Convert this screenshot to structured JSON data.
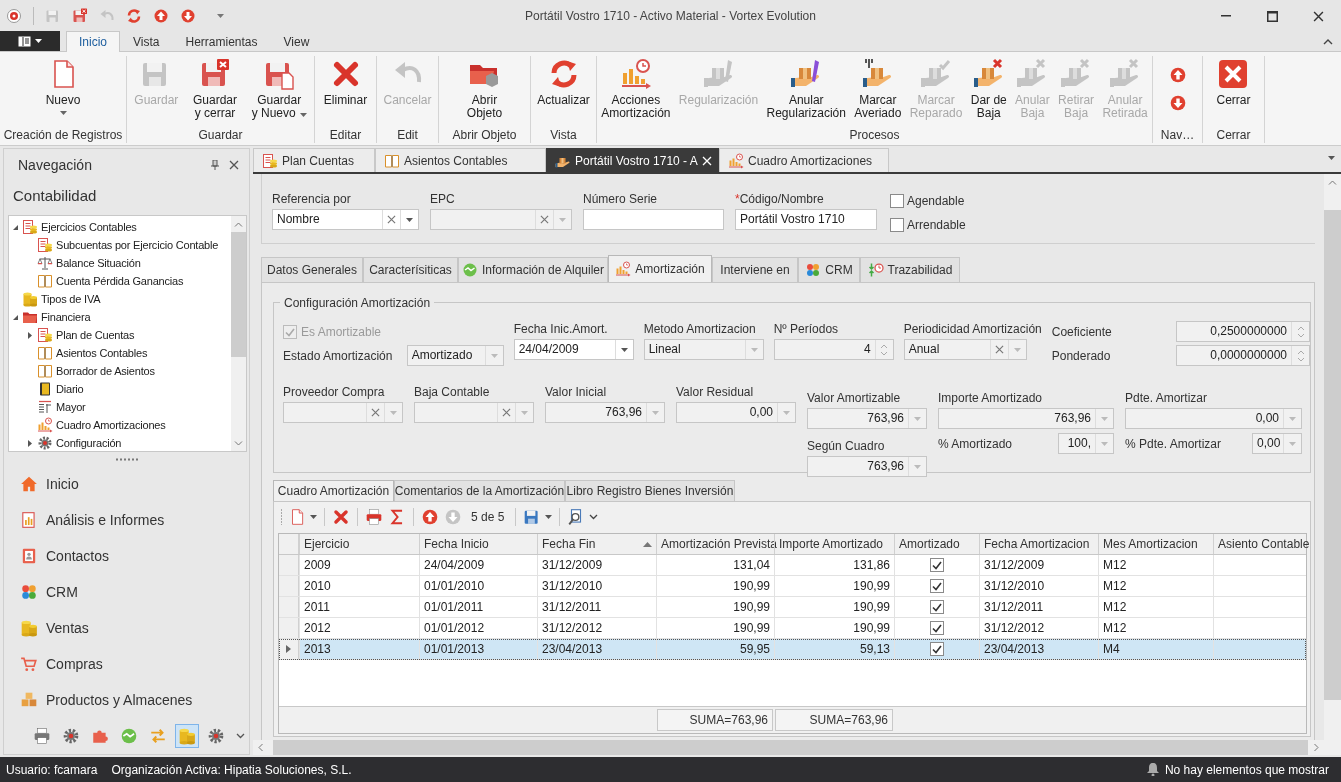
{
  "window": {
    "title": "Portátil Vostro 1710 - Activo Material - Vortex Evolution"
  },
  "ribbon": {
    "tabs": [
      {
        "label": "Inicio",
        "selected": true
      },
      {
        "label": "Vista",
        "selected": false
      },
      {
        "label": "Herramientas",
        "selected": false
      },
      {
        "label": "View",
        "selected": false
      }
    ],
    "groups": [
      {
        "label": "Creación de Registros",
        "buttons": [
          {
            "label": "Nuevo",
            "kind": "new",
            "disabled": false,
            "dropdown": true
          }
        ]
      },
      {
        "label": "Guardar",
        "buttons": [
          {
            "label": "Guardar",
            "kind": "save",
            "disabled": true,
            "dropdown": false
          },
          {
            "label": "Guardar\ny cerrar",
            "kind": "save-close",
            "disabled": false,
            "dropdown": false
          },
          {
            "label": "Guardar\ny Nuevo",
            "kind": "save-new",
            "disabled": false,
            "dropdown": true
          }
        ]
      },
      {
        "label": "Editar",
        "buttons": [
          {
            "label": "Eliminar",
            "kind": "delete",
            "disabled": false,
            "dropdown": false
          }
        ]
      },
      {
        "label": "Edit",
        "buttons": [
          {
            "label": "Cancelar",
            "kind": "undo",
            "disabled": true,
            "dropdown": false
          }
        ]
      },
      {
        "label": "Abrir Objeto",
        "buttons": [
          {
            "label": "Abrir\nObjeto",
            "kind": "open",
            "disabled": false,
            "dropdown": false
          }
        ]
      },
      {
        "label": "Vista",
        "buttons": [
          {
            "label": "Actualizar",
            "kind": "refresh",
            "disabled": false,
            "dropdown": false
          }
        ]
      },
      {
        "label": "Procesos",
        "buttons": [
          {
            "label": "Acciones\nAmortización",
            "kind": "chart",
            "disabled": false,
            "dropdown": false
          },
          {
            "label": "Regularización",
            "kind": "hand-pen",
            "disabled": true,
            "dropdown": false
          },
          {
            "label": "Anular\nRegularización",
            "kind": "hand-pen",
            "disabled": false,
            "dropdown": false
          },
          {
            "label": "Marcar\nAveriado",
            "kind": "hand-wrench",
            "disabled": false,
            "dropdown": false
          },
          {
            "label": "Marcar\nReparado",
            "kind": "hand-check",
            "disabled": true,
            "dropdown": false
          },
          {
            "label": "Dar de\nBaja",
            "kind": "hand-x",
            "disabled": false,
            "dropdown": false
          },
          {
            "label": "Anular\nBaja",
            "kind": "hand-x",
            "disabled": true,
            "dropdown": false
          },
          {
            "label": "Retirar\nBaja",
            "kind": "hand-x",
            "disabled": true,
            "dropdown": false
          },
          {
            "label": "Anular\nRetirada",
            "kind": "hand-x",
            "disabled": true,
            "dropdown": false
          }
        ]
      },
      {
        "label": "Nav…",
        "buttons": [
          {
            "kind": "up",
            "disabled": false,
            "dropdown": false
          },
          {
            "kind": "down",
            "disabled": false,
            "dropdown": false
          }
        ]
      },
      {
        "label": "Cerrar",
        "buttons": [
          {
            "label": "Cerrar",
            "kind": "close",
            "disabled": false,
            "dropdown": false
          }
        ]
      }
    ]
  },
  "navigation": {
    "title": "Navegación",
    "module": "Contabilidad",
    "tree": [
      {
        "label": "Ejercicios Contables",
        "kind": "ledger",
        "expanded": true,
        "children": [
          {
            "label": "Subcuentas por Ejercicio Contable",
            "kind": "ledger"
          },
          {
            "label": "Balance Situación",
            "kind": "scales"
          },
          {
            "label": "Cuenta Pérdida Ganancias",
            "kind": "book"
          }
        ]
      },
      {
        "label": "Tipos de IVA",
        "kind": "coins"
      },
      {
        "label": "Financiera",
        "kind": "folder",
        "expanded": true,
        "children": [
          {
            "label": "Plan de Cuentas",
            "kind": "ledger",
            "expanded": false
          },
          {
            "label": "Asientos Contables",
            "kind": "book"
          },
          {
            "label": "Borrador de Asientos",
            "kind": "book"
          },
          {
            "label": "Diario",
            "kind": "diary"
          },
          {
            "label": "Mayor",
            "kind": "lines"
          },
          {
            "label": "Cuadro Amortizaciones",
            "kind": "chart"
          },
          {
            "label": "Configuración",
            "kind": "gear",
            "expanded": false
          }
        ]
      }
    ],
    "sections": [
      {
        "label": "Inicio",
        "kind": "house"
      },
      {
        "label": "Análisis e Informes",
        "kind": "report"
      },
      {
        "label": "Contactos",
        "kind": "contacts"
      },
      {
        "label": "CRM",
        "kind": "crm"
      },
      {
        "label": "Ventas",
        "kind": "coins"
      },
      {
        "label": "Compras",
        "kind": "cart"
      },
      {
        "label": "Productos y Almacenes",
        "kind": "boxes"
      }
    ],
    "shortcuts": [
      {
        "kind": "printer",
        "selected": false
      },
      {
        "kind": "gear",
        "selected": false
      },
      {
        "kind": "puzzle",
        "selected": false
      },
      {
        "kind": "handshake",
        "selected": false
      },
      {
        "kind": "arrows",
        "selected": false
      },
      {
        "kind": "coins",
        "selected": true
      },
      {
        "kind": "gear",
        "selected": false
      }
    ]
  },
  "document_tabs": [
    {
      "label": "Plan Cuentas",
      "kind": "ledger",
      "selected": false
    },
    {
      "label": "Asientos Contables",
      "kind": "book",
      "selected": false
    },
    {
      "label": "Portátil Vostro 1710 - A",
      "kind": "hand-box",
      "selected": true
    },
    {
      "label": "Cuadro Amortizaciones",
      "kind": "chart",
      "selected": false
    }
  ],
  "header": {
    "fields": [
      {
        "label": "Referencia por",
        "value": "Nombre",
        "kind": "combo-clear",
        "disabled": false
      },
      {
        "label": "EPC",
        "kind": "combo-clear",
        "disabled": true
      },
      {
        "label": "Número Serie",
        "kind": "text",
        "disabled": false
      },
      {
        "label": "Código/Nombre",
        "required_mark": "*",
        "value": "Portátil Vostro 1710",
        "kind": "text",
        "disabled": false
      }
    ],
    "checkboxes": [
      {
        "label": "Agendable",
        "checked": false
      },
      {
        "label": "Arrendable",
        "checked": false
      }
    ]
  },
  "detail_tabs": [
    {
      "label": "Datos Generales",
      "selected": false
    },
    {
      "label": "Caracterísiticas",
      "selected": false
    },
    {
      "label": "Información de Alquiler",
      "kind": "handshake",
      "selected": false
    },
    {
      "label": "Amortización",
      "kind": "chart",
      "selected": true
    },
    {
      "label": "Interviene en",
      "selected": false
    },
    {
      "label": "CRM",
      "kind": "crm",
      "selected": false
    },
    {
      "label": "Trazabilidad",
      "kind": "trace",
      "selected": false
    }
  ],
  "config": {
    "title": "Configuración Amortización",
    "es_amortizable": {
      "label": "Es Amortizable",
      "checked": true,
      "disabled": true
    },
    "estado": {
      "label": "Estado Amortización",
      "value": "Amortizado",
      "kind": "combo",
      "disabled": true
    },
    "top_fields": [
      {
        "label": "Fecha Inic.Amort.",
        "value": "24/04/2009",
        "kind": "combo",
        "disabled": false
      },
      {
        "label": "Metodo Amortizacion",
        "value": "Lineal",
        "kind": "combo",
        "disabled": true
      },
      {
        "label": "Nº Períodos",
        "value": "4",
        "kind": "spin",
        "disabled": true
      },
      {
        "label": "Periodicidad Amortización",
        "value": "Anual",
        "kind": "combo-clear",
        "disabled": true
      }
    ],
    "side_fields": [
      {
        "label": "Coeficiente",
        "value": "0,2500000000",
        "kind": "spin",
        "disabled": true
      },
      {
        "label": "Ponderado",
        "value": "0,0000000000",
        "kind": "spin",
        "disabled": true
      }
    ],
    "bottom_fields": [
      {
        "label": "Proveedor Compra",
        "kind": "combo-clear",
        "disabled": true
      },
      {
        "label": "Baja Contable",
        "kind": "combo-clear",
        "disabled": true
      },
      {
        "label": "Valor Inicial",
        "value": "763,96",
        "kind": "calc",
        "disabled": true
      },
      {
        "label": "Valor Residual",
        "value": "0,00",
        "kind": "calc",
        "disabled": true
      }
    ],
    "totals": [
      {
        "label": "Valor Amortizable",
        "value": "763,96",
        "kind": "calc",
        "disabled": true,
        "sub": {
          "label": "Según Cuadro",
          "value": "763,96",
          "kind": "calc",
          "disabled": true
        }
      },
      {
        "label": "Importe Amortizado",
        "value": "763,96",
        "kind": "calc",
        "disabled": true,
        "sub": {
          "label": "% Amortizado",
          "value": "100,",
          "kind": "calc",
          "disabled": true
        }
      },
      {
        "label": "Pdte. Amortizar",
        "value": "0,00",
        "kind": "calc",
        "disabled": true,
        "sub": {
          "label": "% Pdte. Amortizar",
          "value": "0,00",
          "kind": "calc",
          "disabled": true
        }
      }
    ]
  },
  "schedule": {
    "tabs": [
      {
        "label": "Cuadro Amortización",
        "selected": true
      },
      {
        "label": "Comentarios de la Amortización",
        "selected": false
      },
      {
        "label": "Libro Registro Bienes Inversión",
        "selected": false
      }
    ],
    "toolbar": [
      {
        "kind": "new",
        "dropdown": true,
        "disabled": false
      },
      {
        "kind": "separator"
      },
      {
        "kind": "delete",
        "dropdown": false,
        "disabled": false
      },
      {
        "kind": "separator"
      },
      {
        "kind": "print",
        "dropdown": false,
        "disabled": false
      },
      {
        "kind": "sigma",
        "dropdown": false,
        "disabled": false
      },
      {
        "kind": "separator"
      },
      {
        "kind": "up",
        "dropdown": false,
        "disabled": false
      },
      {
        "kind": "down",
        "dropdown": false,
        "disabled": true
      },
      {
        "kind": "counter",
        "label": "5 de 5"
      },
      {
        "kind": "separator"
      },
      {
        "kind": "save-blue",
        "dropdown": true,
        "disabled": false
      },
      {
        "kind": "separator"
      },
      {
        "kind": "find",
        "dropdown": true,
        "disabled": false
      }
    ],
    "columns": [
      {
        "label": "Ejercicio",
        "kind": "text",
        "sorted": false
      },
      {
        "label": "Fecha Inicio",
        "kind": "text",
        "sorted": false
      },
      {
        "label": "Fecha Fin",
        "kind": "text",
        "sorted": true
      },
      {
        "label": "Amortización Prevista",
        "kind": "number",
        "sorted": false,
        "summary": "SUMA=763,96"
      },
      {
        "label": "Importe Amortizado",
        "kind": "number",
        "sorted": false,
        "summary": "SUMA=763,96"
      },
      {
        "label": "Amortizado",
        "kind": "check",
        "sorted": false
      },
      {
        "label": "Fecha Amortizacion",
        "kind": "text",
        "sorted": false
      },
      {
        "label": "Mes Amortizacion",
        "kind": "text",
        "sorted": false
      },
      {
        "label": "Asiento Contable",
        "kind": "text",
        "sorted": false
      }
    ],
    "rows": [
      {
        "selected": false,
        "cells": [
          "2009",
          "24/04/2009",
          "31/12/2009",
          "131,04",
          "131,86",
          true,
          "31/12/2009",
          "M12"
        ]
      },
      {
        "selected": false,
        "cells": [
          "2010",
          "01/01/2010",
          "31/12/2010",
          "190,99",
          "190,99",
          true,
          "31/12/2010",
          "M12"
        ]
      },
      {
        "selected": false,
        "cells": [
          "2011",
          "01/01/2011",
          "31/12/2011",
          "190,99",
          "190,99",
          true,
          "31/12/2011",
          "M12"
        ]
      },
      {
        "selected": false,
        "cells": [
          "2012",
          "01/01/2012",
          "31/12/2012",
          "190,99",
          "190,99",
          true,
          "31/12/2012",
          "M12"
        ]
      },
      {
        "selected": true,
        "cells": [
          "2013",
          "01/01/2013",
          "23/04/2013",
          "59,95",
          "59,13",
          true,
          "23/04/2013",
          "M4"
        ]
      }
    ]
  },
  "status_bar": {
    "user": "Usuario: fcamara",
    "organization": "Organización Activa: Hipatia Soluciones, S.L.",
    "notifications": "No hay elementos que mostrar"
  }
}
